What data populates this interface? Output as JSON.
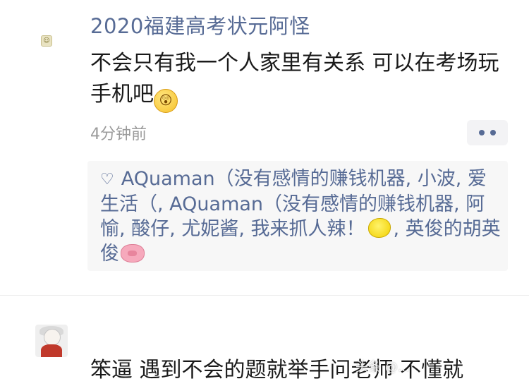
{
  "post1": {
    "username": "2020福建高考状元阿怪",
    "content": "不会只有我一个人家里有关系 可以在考场玩手机吧",
    "emoji_icon": "shocked-face-emoji",
    "time": "4分钟前",
    "likes": {
      "heart_icon": "heart-outline-icon",
      "names_part1": "AQuaman（没有感情的赚钱机器, 小波, 爱生活（, AQuaman（没有感情的赚钱机器, 阿愉, 酸仔, 尤妮酱, 我来抓人辣！",
      "lemon_icon": "lemon-emoji",
      "names_part2": ", 英俊的胡英俊",
      "pig_icon": "pig-nose-emoji"
    }
  },
  "post2": {
    "content": "笨逼 遇到不会的题就举手问老师 不懂就"
  },
  "watermark": "头条 @...",
  "colors": {
    "link": "#576b95",
    "text": "#1a1a1a",
    "muted": "#9b9b9b",
    "likes_bg": "#f7f7f7"
  }
}
